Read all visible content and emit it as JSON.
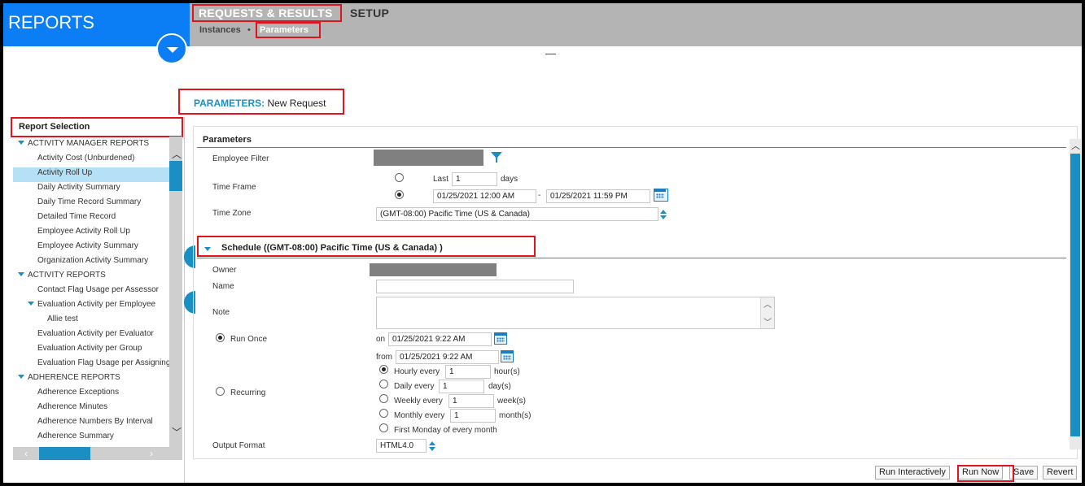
{
  "header": {
    "brand": "REPORTS",
    "tabs": [
      "REQUESTS & RESULTS",
      "SETUP"
    ],
    "subnav": [
      "Instances",
      "Parameters"
    ],
    "separator": "•"
  },
  "page": {
    "title_key": "PARAMETERS:",
    "title_value": "New Request",
    "dash": "—"
  },
  "left": {
    "heading": "Report Selection",
    "items": [
      {
        "label": "ACTIVITY MANAGER REPORTS",
        "type": "group"
      },
      {
        "label": "Activity Cost (Unburdened)",
        "type": "leaf"
      },
      {
        "label": "Activity Roll Up",
        "type": "leaf",
        "selected": true
      },
      {
        "label": "Daily Activity Summary",
        "type": "leaf"
      },
      {
        "label": "Daily Time Record Summary",
        "type": "leaf"
      },
      {
        "label": "Detailed Time Record",
        "type": "leaf"
      },
      {
        "label": "Employee Activity Roll Up",
        "type": "leaf"
      },
      {
        "label": "Employee Activity Summary",
        "type": "leaf"
      },
      {
        "label": "Organization Activity Summary",
        "type": "leaf"
      },
      {
        "label": "ACTIVITY REPORTS",
        "type": "group"
      },
      {
        "label": "Contact Flag Usage per Assessor",
        "type": "leaf"
      },
      {
        "label": "Evaluation Activity per Employee",
        "type": "subgroup"
      },
      {
        "label": "Allie test",
        "type": "leaf2"
      },
      {
        "label": "Evaluation Activity per Evaluator",
        "type": "leaf"
      },
      {
        "label": "Evaluation Activity per Group",
        "type": "leaf"
      },
      {
        "label": "Evaluation Flag Usage per Assigning",
        "type": "leaf"
      },
      {
        "label": "ADHERENCE REPORTS",
        "type": "group"
      },
      {
        "label": "Adherence Exceptions",
        "type": "leaf"
      },
      {
        "label": "Adherence Minutes",
        "type": "leaf"
      },
      {
        "label": "Adherence Numbers By Interval",
        "type": "leaf"
      },
      {
        "label": "Adherence Summary",
        "type": "leaf"
      }
    ]
  },
  "params": {
    "heading": "Parameters",
    "employee_filter_label": "Employee Filter",
    "time_frame_label": "Time Frame",
    "last_label": "Last",
    "last_value": "1",
    "days_label": "days",
    "start_datetime": "01/25/2021 12:00 AM",
    "range_sep": "-",
    "end_datetime": "01/25/2021 11:59 PM",
    "time_zone_label": "Time Zone",
    "time_zone_value": "(GMT-08:00) Pacific Time (US & Canada)"
  },
  "schedule": {
    "heading": "Schedule ((GMT-08:00) Pacific Time (US & Canada) )",
    "owner_label": "Owner",
    "name_label": "Name",
    "name_value": "",
    "note_label": "Note",
    "run_once_label": "Run Once",
    "on_label": "on",
    "on_value": "01/25/2021 9:22 AM",
    "from_label": "from",
    "from_value": "01/25/2021 9:22 AM",
    "recurring_label": "Recurring",
    "hourly_label": "Hourly every",
    "hourly_value": "1",
    "hourly_unit": "hour(s)",
    "daily_label": "Daily every",
    "daily_value": "1",
    "daily_unit": "day(s)",
    "weekly_label": "Weekly every",
    "weekly_value": "1",
    "weekly_unit": "week(s)",
    "monthly_label": "Monthly every",
    "monthly_value": "1",
    "monthly_unit": "month(s)",
    "first_monday_label": "First Monday of every month",
    "output_format_label": "Output Format",
    "output_format_value": "HTML4.0"
  },
  "buttons": {
    "run_interactively": "Run Interactively",
    "run_now": "Run Now",
    "save": "Save",
    "revert": "Revert"
  },
  "colors": {
    "brand_blue": "#0b7df5",
    "accent": "#1a8fc4",
    "highlight_box": "#e0141e",
    "header_gray": "#b4b4b4"
  }
}
